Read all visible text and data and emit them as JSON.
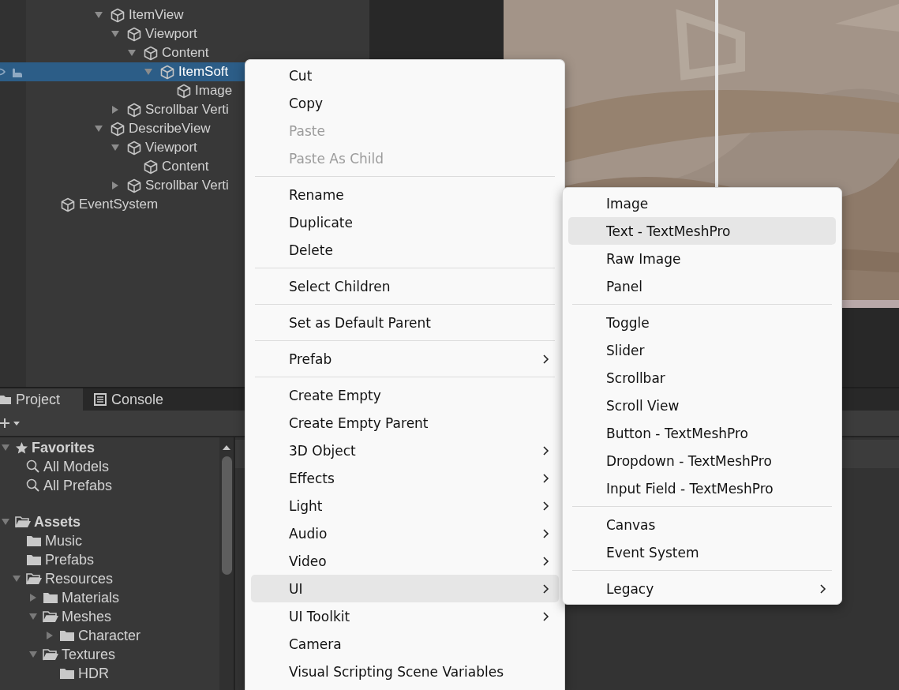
{
  "hierarchy": {
    "items": [
      {
        "name": "ItemView",
        "expanded": true,
        "selected": false,
        "children": [
          {
            "name": "Viewport",
            "expanded": true,
            "selected": false,
            "children": [
              {
                "name": "Content",
                "expanded": true,
                "selected": false,
                "children": [
                  {
                    "name": "ItemSoft",
                    "expanded": true,
                    "selected": true,
                    "children": [
                      {
                        "name": "Image",
                        "selected": false
                      }
                    ]
                  }
                ]
              }
            ]
          },
          {
            "name": "Scrollbar Verti",
            "expanded": false,
            "selected": false
          }
        ]
      },
      {
        "name": "DescribeView",
        "expanded": true,
        "selected": false,
        "children": [
          {
            "name": "Viewport",
            "expanded": true,
            "selected": false,
            "children": [
              {
                "name": "Content",
                "selected": false
              }
            ]
          },
          {
            "name": "Scrollbar Verti",
            "expanded": false,
            "selected": false
          }
        ]
      }
    ],
    "root_items": [
      {
        "name": "EventSystem",
        "selected": false
      }
    ]
  },
  "bottom_tabs": [
    {
      "label": "Project",
      "selected": true
    },
    {
      "label": "Console",
      "selected": false
    }
  ],
  "project": {
    "sections": [
      {
        "label": "Favorites",
        "kind": "favorites",
        "expanded": true,
        "children": [
          {
            "label": "All Models",
            "kind": "search"
          },
          {
            "label": "All Prefabs",
            "kind": "search"
          }
        ]
      },
      {
        "label": "Assets",
        "kind": "folder",
        "expanded": true,
        "children": [
          {
            "label": "Music",
            "kind": "folder"
          },
          {
            "label": "Prefabs",
            "kind": "folder"
          },
          {
            "label": "Resources",
            "kind": "folder",
            "expanded": true,
            "children": [
              {
                "label": "Materials",
                "kind": "folder",
                "expanded": false
              },
              {
                "label": "Meshes",
                "kind": "folder",
                "expanded": true,
                "children": [
                  {
                    "label": "Character",
                    "kind": "folder",
                    "expanded": false
                  }
                ]
              },
              {
                "label": "Textures",
                "kind": "folder",
                "expanded": true,
                "children": [
                  {
                    "label": "HDR",
                    "kind": "folder"
                  }
                ]
              }
            ]
          }
        ]
      }
    ]
  },
  "context_menu": {
    "items": [
      {
        "kind": "item",
        "label": "Cut",
        "disabled": false,
        "submenu": false,
        "selected": false
      },
      {
        "kind": "item",
        "label": "Copy",
        "disabled": false,
        "submenu": false,
        "selected": false
      },
      {
        "kind": "item",
        "label": "Paste",
        "disabled": true,
        "submenu": false,
        "selected": false
      },
      {
        "kind": "item",
        "label": "Paste As Child",
        "disabled": true,
        "submenu": false,
        "selected": false
      },
      {
        "kind": "separator"
      },
      {
        "kind": "item",
        "label": "Rename",
        "disabled": false,
        "submenu": false,
        "selected": false
      },
      {
        "kind": "item",
        "label": "Duplicate",
        "disabled": false,
        "submenu": false,
        "selected": false
      },
      {
        "kind": "item",
        "label": "Delete",
        "disabled": false,
        "submenu": false,
        "selected": false
      },
      {
        "kind": "separator"
      },
      {
        "kind": "item",
        "label": "Select Children",
        "disabled": false,
        "submenu": false,
        "selected": false
      },
      {
        "kind": "separator"
      },
      {
        "kind": "item",
        "label": "Set as Default Parent",
        "disabled": false,
        "submenu": false,
        "selected": false
      },
      {
        "kind": "separator"
      },
      {
        "kind": "item",
        "label": "Prefab",
        "disabled": false,
        "submenu": true,
        "selected": false
      },
      {
        "kind": "separator"
      },
      {
        "kind": "item",
        "label": "Create Empty",
        "disabled": false,
        "submenu": false,
        "selected": false
      },
      {
        "kind": "item",
        "label": "Create Empty Parent",
        "disabled": false,
        "submenu": false,
        "selected": false
      },
      {
        "kind": "item",
        "label": "3D Object",
        "disabled": false,
        "submenu": true,
        "selected": false
      },
      {
        "kind": "item",
        "label": "Effects",
        "disabled": false,
        "submenu": true,
        "selected": false
      },
      {
        "kind": "item",
        "label": "Light",
        "disabled": false,
        "submenu": true,
        "selected": false
      },
      {
        "kind": "item",
        "label": "Audio",
        "disabled": false,
        "submenu": true,
        "selected": false
      },
      {
        "kind": "item",
        "label": "Video",
        "disabled": false,
        "submenu": true,
        "selected": false
      },
      {
        "kind": "item",
        "label": "UI",
        "disabled": false,
        "submenu": true,
        "selected": true
      },
      {
        "kind": "item",
        "label": "UI Toolkit",
        "disabled": false,
        "submenu": true,
        "selected": false
      },
      {
        "kind": "item",
        "label": "Camera",
        "disabled": false,
        "submenu": false,
        "selected": false
      },
      {
        "kind": "item",
        "label": "Visual Scripting Scene Variables",
        "disabled": false,
        "submenu": false,
        "selected": false
      }
    ]
  },
  "submenu": {
    "items": [
      {
        "kind": "item",
        "label": "Image",
        "submenu": false,
        "selected": false
      },
      {
        "kind": "item",
        "label": "Text - TextMeshPro",
        "submenu": false,
        "selected": true
      },
      {
        "kind": "item",
        "label": "Raw Image",
        "submenu": false,
        "selected": false
      },
      {
        "kind": "item",
        "label": "Panel",
        "submenu": false,
        "selected": false
      },
      {
        "kind": "separator"
      },
      {
        "kind": "item",
        "label": "Toggle",
        "submenu": false,
        "selected": false
      },
      {
        "kind": "item",
        "label": "Slider",
        "submenu": false,
        "selected": false
      },
      {
        "kind": "item",
        "label": "Scrollbar",
        "submenu": false,
        "selected": false
      },
      {
        "kind": "item",
        "label": "Scroll View",
        "submenu": false,
        "selected": false
      },
      {
        "kind": "item",
        "label": "Button - TextMeshPro",
        "submenu": false,
        "selected": false
      },
      {
        "kind": "item",
        "label": "Dropdown - TextMeshPro",
        "submenu": false,
        "selected": false
      },
      {
        "kind": "item",
        "label": "Input Field - TextMeshPro",
        "submenu": false,
        "selected": false
      },
      {
        "kind": "separator"
      },
      {
        "kind": "item",
        "label": "Canvas",
        "submenu": false,
        "selected": false
      },
      {
        "kind": "item",
        "label": "Event System",
        "submenu": false,
        "selected": false
      },
      {
        "kind": "separator"
      },
      {
        "kind": "item",
        "label": "Legacy",
        "submenu": true,
        "selected": false
      }
    ]
  }
}
